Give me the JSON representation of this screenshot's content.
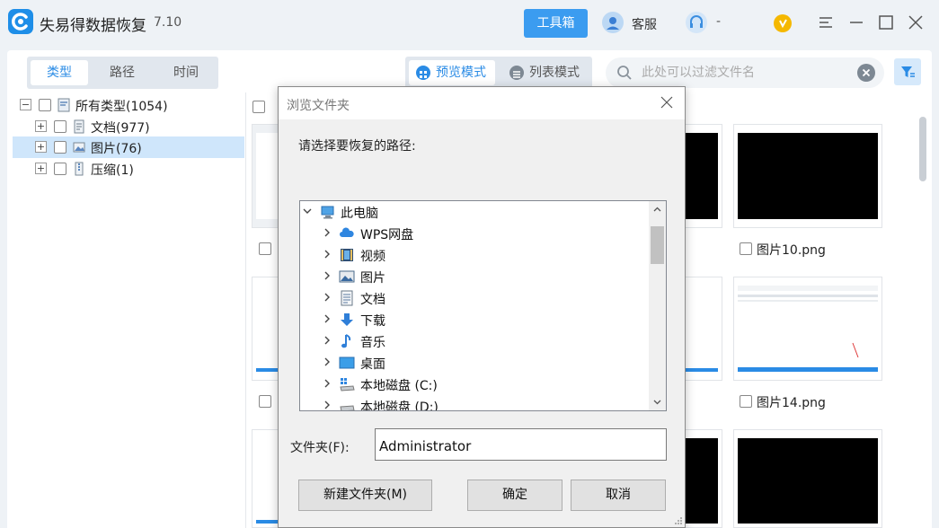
{
  "app": {
    "title": "失易得数据恢复",
    "version": "7.10",
    "toolbox_label": "工具箱",
    "service_label": "客服",
    "account_label": "-"
  },
  "tabs": [
    {
      "label": "类型",
      "active": true
    },
    {
      "label": "路径",
      "active": false
    },
    {
      "label": "时间",
      "active": false
    }
  ],
  "view_modes": {
    "preview_label": "预览模式",
    "list_label": "列表模式",
    "active": "preview"
  },
  "filter": {
    "placeholder": "此处可以过滤文件名"
  },
  "tree": [
    {
      "label": "所有类型(1054)",
      "expander": "−",
      "icon": "category-icon"
    },
    {
      "label": "文档(977)",
      "expander": "+",
      "icon": "document-icon"
    },
    {
      "label": "图片(76)",
      "expander": "+",
      "icon": "picture-icon",
      "selected": true
    },
    {
      "label": "压缩(1)",
      "expander": "+",
      "icon": "archive-icon"
    }
  ],
  "thumbnails": [
    {
      "name": "图片10.png",
      "content": "black"
    },
    {
      "name": "图片14.png",
      "content": "screenshot"
    },
    {
      "name": "",
      "content": "black"
    }
  ],
  "dialog": {
    "title": "浏览文件夹",
    "prompt": "请选择要恢复的路径:",
    "folders": [
      {
        "label": "此电脑",
        "icon": "computer-icon",
        "expanded": true,
        "level": 0
      },
      {
        "label": "WPS网盘",
        "icon": "cloud-icon",
        "level": 1
      },
      {
        "label": "视频",
        "icon": "video-icon",
        "level": 1
      },
      {
        "label": "图片",
        "icon": "pictures-folder-icon",
        "level": 1
      },
      {
        "label": "文档",
        "icon": "documents-folder-icon",
        "level": 1
      },
      {
        "label": "下载",
        "icon": "download-icon",
        "level": 1
      },
      {
        "label": "音乐",
        "icon": "music-icon",
        "level": 1
      },
      {
        "label": "桌面",
        "icon": "desktop-icon",
        "level": 1
      },
      {
        "label": "本地磁盘 (C:)",
        "icon": "system-drive-icon",
        "level": 1
      },
      {
        "label": "本地磁盘 (D:)",
        "icon": "drive-icon",
        "level": 1
      }
    ],
    "folder_field_label": "文件夹(F):",
    "folder_field_value": "Administrator",
    "new_folder_label": "新建文件夹(M)",
    "ok_label": "确定",
    "cancel_label": "取消"
  },
  "colors": {
    "accent": "#3b9cf0",
    "selected_row": "#cfe6fb",
    "background": "#eef2f6"
  }
}
